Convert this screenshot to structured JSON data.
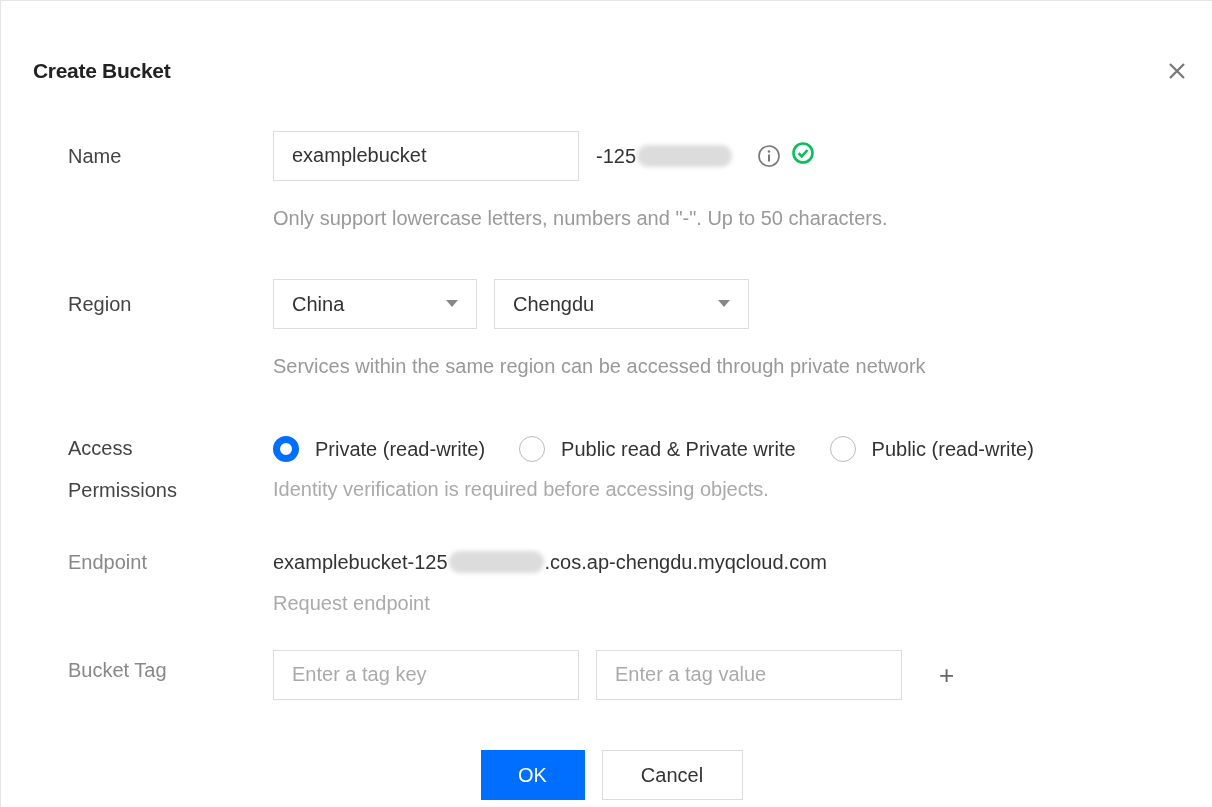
{
  "dialog": {
    "title": "Create Bucket"
  },
  "name": {
    "label": "Name",
    "dimmed": false,
    "value": "examplebucket",
    "suffix": "-125",
    "valid": true,
    "hint": "Only support lowercase letters, numbers and \"-\". Up to 50 characters."
  },
  "region": {
    "label": "Region",
    "dimmed": false,
    "selects": [
      {
        "value": "China"
      },
      {
        "value": "Chengdu"
      }
    ],
    "hint": "Services within the same region can be accessed through private network"
  },
  "access": {
    "label": "Access Permissions",
    "dimmed": false,
    "options": [
      {
        "label": "Private (read-write)",
        "selected": true
      },
      {
        "label": "Public read & Private write",
        "selected": false
      },
      {
        "label": "Public (read-write)",
        "selected": false
      }
    ],
    "hint": "Identity verification is required before accessing objects."
  },
  "endpoint": {
    "label": "Endpoint",
    "dimmed": true,
    "prefix": "examplebucket-125",
    "suffix": ".cos.ap-chengdu.myqcloud.com",
    "hint": "Request endpoint"
  },
  "tag": {
    "label": "Bucket Tag",
    "dimmed": true,
    "key_placeholder": "Enter a tag key",
    "value_placeholder": "Enter a tag value",
    "add": "+"
  },
  "buttons": [
    {
      "label": "OK",
      "kind": "primary"
    },
    {
      "label": "Cancel",
      "kind": "default"
    }
  ]
}
